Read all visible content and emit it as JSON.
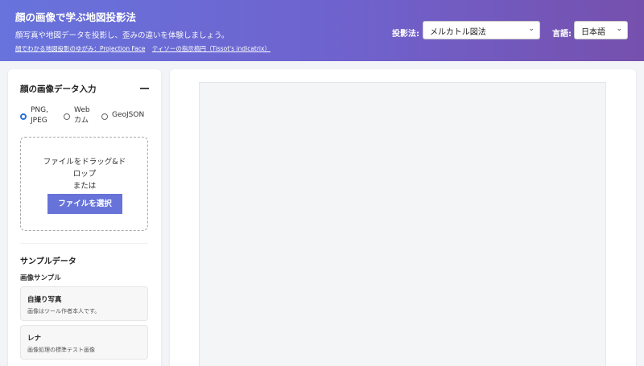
{
  "header": {
    "title": "顔の画像で学ぶ地図投影法",
    "subtitle": "顔写真や地図データを投影し、歪みの違いを体験しましょう。",
    "links": [
      "顔でわかる地図投影のゆがみ：Projection Face",
      "ティソーの指示楕円（Tissot's indicatrix）"
    ],
    "projection_label": "投影法:",
    "projection_value": "メルカトル図法",
    "language_label": "言語:",
    "language_value": "日本語"
  },
  "input_panel": {
    "title": "顔の画像データ入力",
    "radios": [
      {
        "label_line1": "PNG,",
        "label_line2": "JPEG",
        "selected": true
      },
      {
        "label_line1": "Web",
        "label_line2": "カム",
        "selected": false
      },
      {
        "label_line1": "GeoJSON",
        "label_line2": "",
        "selected": false
      }
    ],
    "dropzone_line1": "ファイルをドラッグ&ド",
    "dropzone_line2": "ロップ",
    "dropzone_line3": "または",
    "file_button": "ファイルを選択"
  },
  "samples": {
    "heading": "サンプルデータ",
    "subheading": "画像サンプル",
    "items": [
      {
        "title": "自撮り写真",
        "desc": "画像はツール作者本人です。"
      },
      {
        "title": "レナ",
        "desc": "画像処理の標準テスト画像"
      }
    ]
  },
  "colors": {
    "header_gradient_start": "#6873dc",
    "header_gradient_end": "#7650ad",
    "button": "#6773d8",
    "radio_selected": "#2a6fe0"
  }
}
